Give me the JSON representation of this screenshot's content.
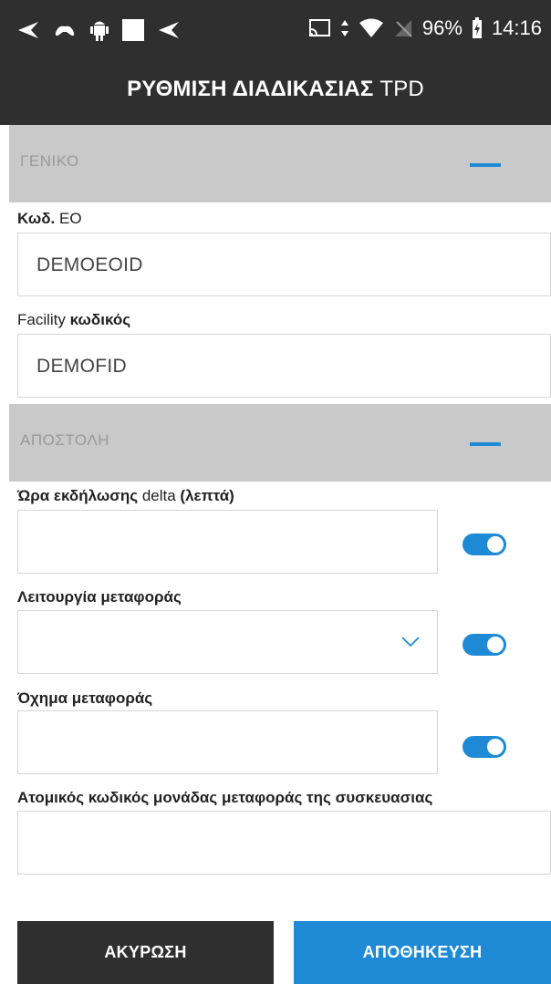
{
  "status_bar": {
    "battery_percent": "96%",
    "time": "14:16"
  },
  "header": {
    "title_bold": "ΡΥΘΜΙΣΗ ΔΙΑΔΙΚΑΣΙΑΣ",
    "title_regular": "TPD"
  },
  "sections": {
    "general": {
      "label": "ΓΕΝΙΚΟ"
    },
    "shipment": {
      "label": "ΑΠΟΣΤΟΛΗ"
    }
  },
  "fields": {
    "eo_code": {
      "label_bold": "Κωδ.",
      "label_regular": "EO",
      "value": "DEMOEOID"
    },
    "facility_code": {
      "label_regular": "Facility",
      "label_bold": "κωδικός",
      "value": "DEMOFID"
    },
    "event_time_delta": {
      "label_bold_1": "Ώρα εκδήλωσης",
      "label_regular": "delta",
      "label_bold_2": "(λεπτά)",
      "value": ""
    },
    "transport_mode": {
      "label": "Λειτουργία μεταφοράς",
      "value": ""
    },
    "transport_vehicle": {
      "label": "Όχημα μεταφοράς",
      "value": ""
    },
    "unit_identifier": {
      "label": "Ατομικός κωδικός μονάδας μεταφοράς της συσκευασιας",
      "value": ""
    }
  },
  "buttons": {
    "cancel": "ΑΚΥΡΩΣΗ",
    "save": "ΑΠΟΘΗΚΕΥΣΗ"
  },
  "colors": {
    "accent": "#1e8ad6",
    "header_bg": "#2f2f2f",
    "section_bg": "#c9c9c9"
  }
}
